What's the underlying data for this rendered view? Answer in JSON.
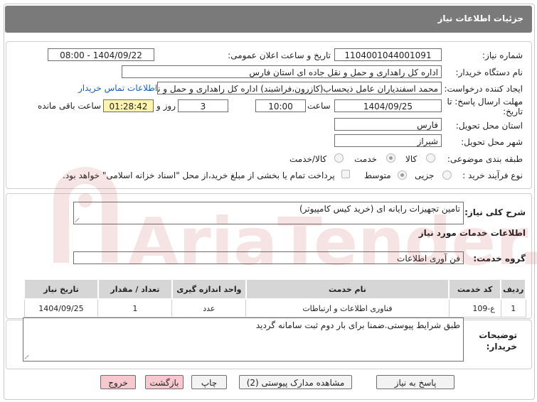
{
  "header": {
    "title": "جزئیات اطلاعات نیاز"
  },
  "form": {
    "need_number": {
      "label": "شماره نیاز:",
      "value": "1104001044001091"
    },
    "announce_datetime": {
      "label": "تاریخ و ساعت اعلان عمومی:",
      "value": "1404/09/22 - 08:00"
    },
    "buyer_org": {
      "label": "نام دستگاه خریدار:",
      "value": "اداره کل راهداری و حمل و نقل جاده ای استان فارس"
    },
    "requester": {
      "label": "ایجاد کننده درخواست:",
      "value": "محمد اسفندیاران عامل ذیحساب(کازرون،فراشبند) اداره کل راهداری و حمل و نقل",
      "contact_link": "اطلاعات تماس خریدار"
    },
    "deadline": {
      "label": "مهلت ارسال پاسخ: تا تاریخ:",
      "date": "1404/09/25",
      "time_label": "ساعت",
      "time": "10:00",
      "days": "3",
      "days_label": "روز و",
      "remaining": "01:28:42",
      "remaining_label": "ساعت باقی مانده"
    },
    "province": {
      "label": "استان محل تحویل:",
      "value": "فارس"
    },
    "city": {
      "label": "شهر محل تحویل:",
      "value": "شیراز"
    },
    "category": {
      "label": "طبقه بندی موضوعی:",
      "options": [
        "کالا",
        "خدمت",
        "کالا/خدمت"
      ],
      "selected": "خدمت"
    },
    "purchase_type": {
      "label": "نوع فرآیند خرید :",
      "options": [
        "جزیی",
        "متوسط"
      ],
      "selected": "متوسط",
      "note": "پرداخت تمام یا بخشی از مبلغ خرید،از محل \"اسناد خزانه اسلامی\" خواهد بود."
    }
  },
  "summary": {
    "label": "شرح کلی نیاز:",
    "value": "تامین تجهیزات رایانه ای (خرید کیس کامپیوتر)"
  },
  "services": {
    "section_title": "اطلاعات خدمات مورد نیاز",
    "group_label": "گروه خدمت:",
    "group_value": "فن آوری اطلاعات",
    "table": {
      "headers": [
        "ردیف",
        "کد خدمت",
        "نام خدمت",
        "واحد اندازه گیری",
        "تعداد / مقدار",
        "تاریخ نیاز"
      ],
      "rows": [
        [
          "1",
          "ع-109",
          "فناوری اطلاعات و ارتباطات",
          "عدد",
          "1",
          "1404/09/25"
        ]
      ]
    }
  },
  "buyer_notes": {
    "label": "توضیحات خریدار:",
    "value": "طبق شرایط پیوستی.ضمنا برای بار دوم ثبت سامانه گردید"
  },
  "buttons": {
    "reply": "پاسخ به نیاز",
    "attachments": "مشاهده مدارک پیوستی (2)",
    "print": "چاپ",
    "back": "بازگشت",
    "exit": "خروج"
  },
  "watermark": {
    "text": "AriaTender.net"
  },
  "colors": {
    "title_bar": "#7a7a7a",
    "remaining_bg": "#fff3b0",
    "pink_button": "#f7c9cf",
    "link": "#1a5fc0"
  }
}
